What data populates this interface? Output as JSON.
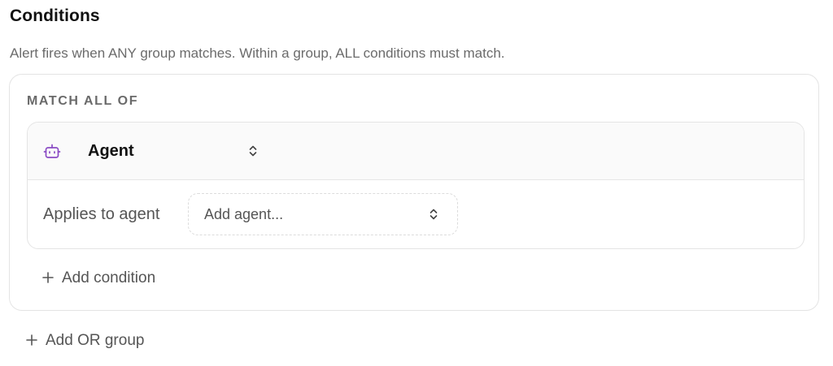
{
  "section": {
    "title": "Conditions",
    "description": "Alert fires when ANY group matches. Within a group, ALL conditions must match."
  },
  "group": {
    "label": "MATCH ALL OF",
    "condition": {
      "type_label": "Agent",
      "type_icon": "robot-icon",
      "field_label": "Applies to agent",
      "agent_placeholder": "Add agent..."
    },
    "add_condition_label": "Add condition"
  },
  "add_or_group_label": "Add OR group",
  "colors": {
    "accent_icon": "#8a4bc4",
    "muted_text": "#555555",
    "border": "#e4e4e4",
    "header_bg": "#fafafa"
  }
}
